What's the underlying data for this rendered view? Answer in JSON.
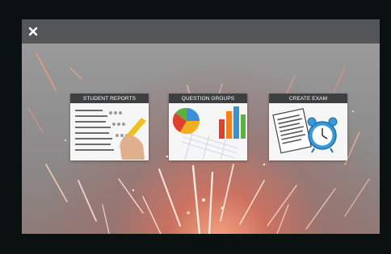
{
  "window": {
    "close_icon": "close-icon",
    "colors": {
      "titlebar": "#545759",
      "tile_label": "#3d3f40",
      "tile": "#f3f3f3"
    }
  },
  "tiles": [
    {
      "label": "STUDENT REPORTS",
      "icon": "answer-sheet-pencil-icon"
    },
    {
      "label": "QUESTION GROUPS",
      "icon": "charts-icon"
    },
    {
      "label": "CREATE EXAM",
      "icon": "exam-alarm-clock-icon"
    }
  ]
}
